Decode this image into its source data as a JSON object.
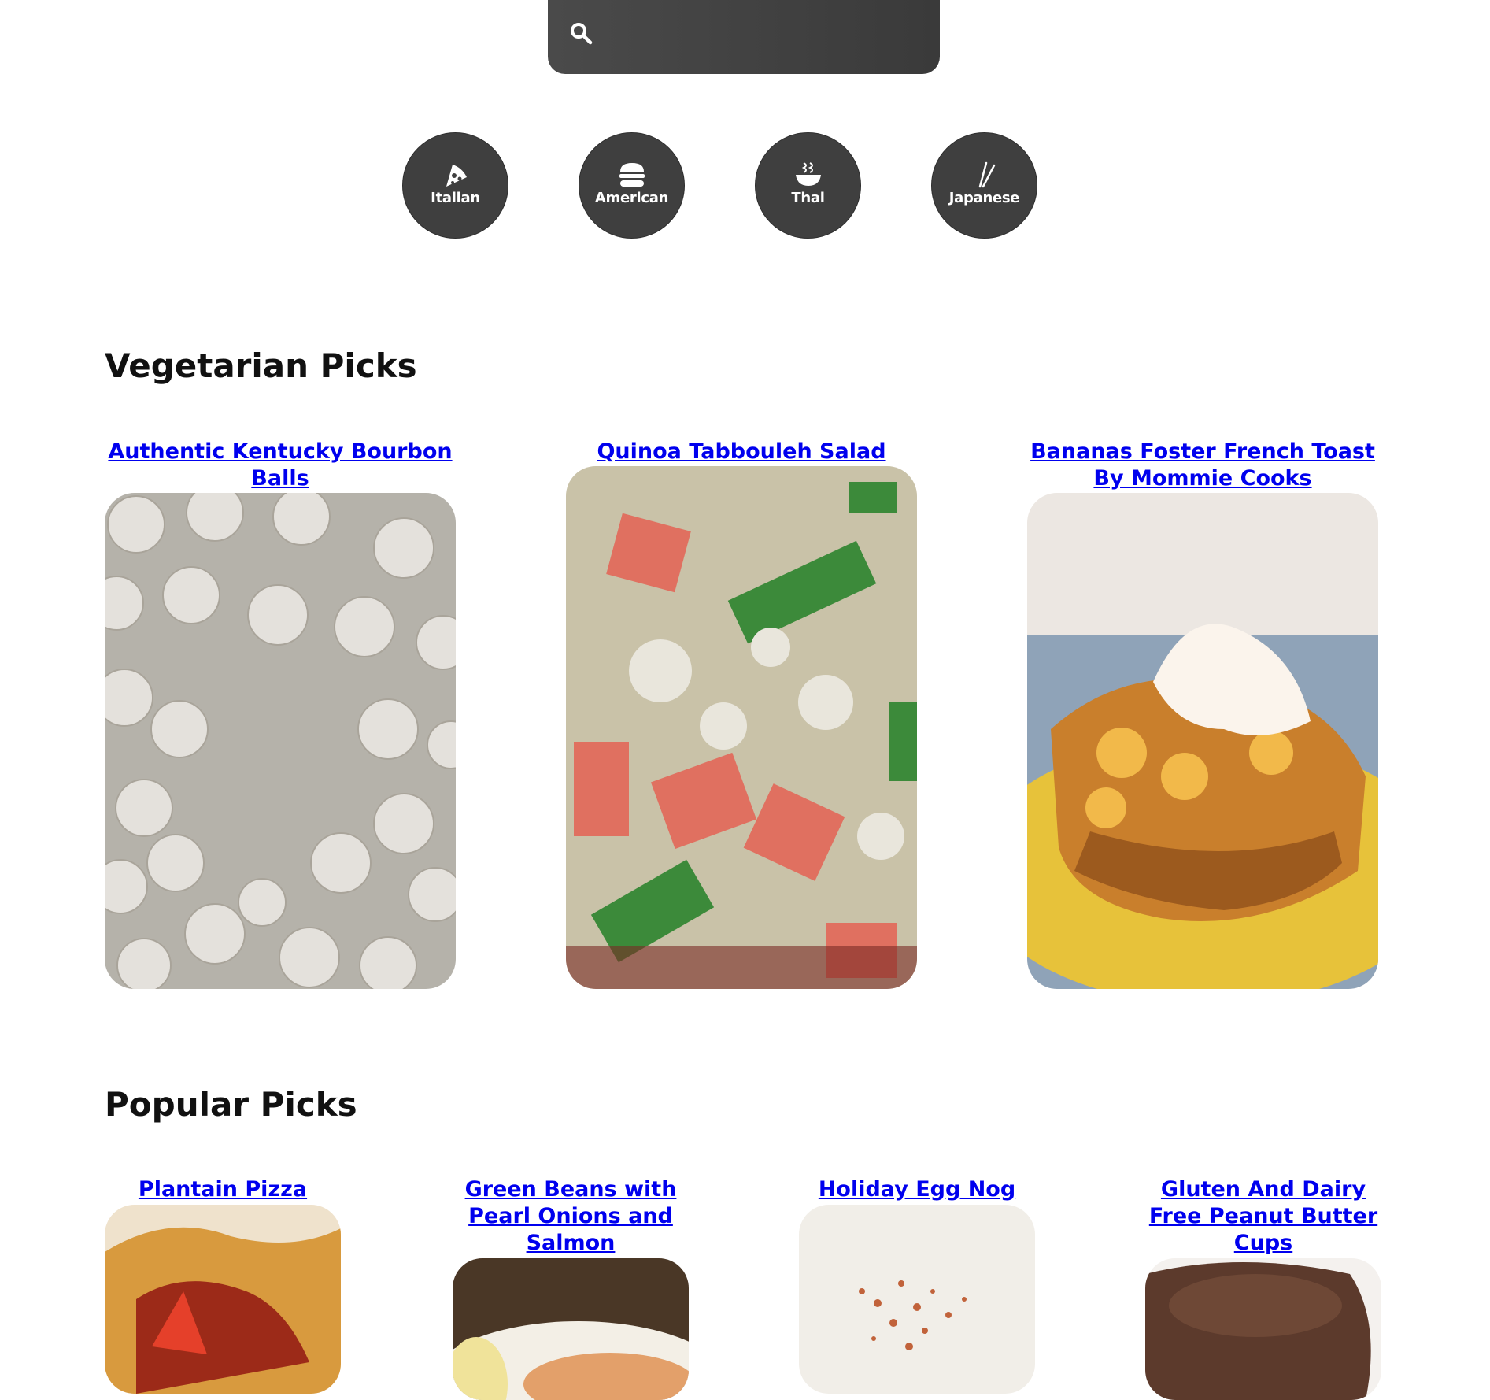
{
  "search": {
    "placeholder": ""
  },
  "cuisines": [
    {
      "label": "Italian",
      "icon": "pizza-icon"
    },
    {
      "label": "American",
      "icon": "burger-icon"
    },
    {
      "label": "Thai",
      "icon": "noodle-bowl-icon"
    },
    {
      "label": "Japanese",
      "icon": "chopsticks-icon"
    }
  ],
  "vegetarian": {
    "heading": "Vegetarian Picks",
    "recipes": [
      {
        "title": "Authentic Kentucky Bourbon Balls"
      },
      {
        "title": "Quinoa Tabbouleh Salad"
      },
      {
        "title": "Bananas Foster French Toast By Mommie Cooks"
      }
    ]
  },
  "popular": {
    "heading": "Popular Picks",
    "recipes": [
      {
        "title": "Plantain Pizza"
      },
      {
        "title": "Green Beans with Pearl Onions and Salmon"
      },
      {
        "title": "Holiday Egg Nog"
      },
      {
        "title": "Gluten And Dairy Free Peanut Butter Cups"
      }
    ]
  },
  "colors": {
    "accent": "#3f3f3f",
    "link": "#0000ee",
    "background": "#ffffff"
  }
}
